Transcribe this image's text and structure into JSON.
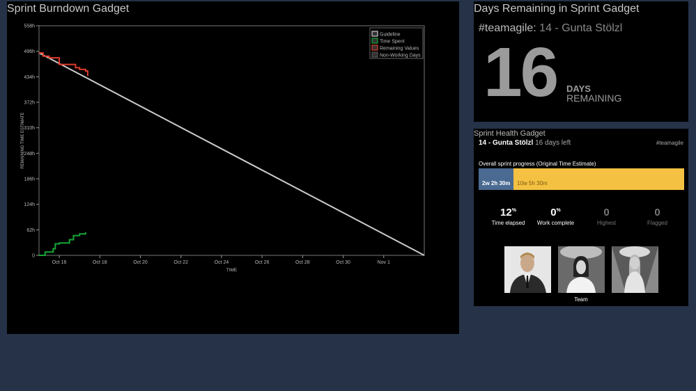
{
  "burndown": {
    "title": "Sprint Burndown Gadget",
    "legend": [
      "Guideline",
      "Time Spent",
      "Remaining Values",
      "Non-Working Days"
    ],
    "legend_colors": [
      "#cccccc",
      "#14a837",
      "#e03c2d",
      "#555555"
    ],
    "chart_data": {
      "type": "line",
      "ylabel": "REMAINING TIME ESTIMATE",
      "xlabel": "TIME",
      "y_ticks": [
        "0",
        "62h",
        "124h",
        "186h",
        "248h",
        "310h",
        "372h",
        "434h",
        "496h",
        "558h"
      ],
      "x_ticks": [
        "Oct 16",
        "Oct 18",
        "Oct 20",
        "Oct 22",
        "Oct 24",
        "Oct 26",
        "Oct 28",
        "Oct 30",
        "Nov 1"
      ],
      "ylim": [
        0,
        558
      ],
      "grid": false,
      "legend_position": "top-right",
      "series": [
        {
          "name": "Guideline",
          "color": "#cccccc",
          "points": [
            [
              "Oct 15",
              492
            ],
            [
              "Nov 3",
              0
            ]
          ]
        },
        {
          "name": "Remaining Values",
          "color": "#e03c2d",
          "points": [
            [
              "Oct 15",
              492
            ],
            [
              "Oct 15.2",
              484
            ],
            [
              "Oct 15.5",
              480
            ],
            [
              "Oct 15.8",
              480
            ],
            [
              "Oct 16",
              464
            ],
            [
              "Oct 16.3",
              464
            ],
            [
              "Oct 16.5",
              464
            ],
            [
              "Oct 16.8",
              456
            ],
            [
              "Oct 17",
              452
            ],
            [
              "Oct 17.3",
              448
            ],
            [
              "Oct 17.4",
              436
            ]
          ]
        },
        {
          "name": "Time Spent",
          "color": "#14a837",
          "points": [
            [
              "Oct 15",
              0
            ],
            [
              "Oct 15.3",
              8
            ],
            [
              "Oct 15.7",
              16
            ],
            [
              "Oct 15.8",
              28
            ],
            [
              "Oct 16",
              30
            ],
            [
              "Oct 16.4",
              30
            ],
            [
              "Oct 16.5",
              38
            ],
            [
              "Oct 16.7",
              48
            ],
            [
              "Oct 17",
              52
            ],
            [
              "Oct 17.3",
              56
            ]
          ]
        }
      ]
    }
  },
  "days_remaining": {
    "title": "Days Remaining in Sprint Gadget",
    "team_tag": "#teamagile:",
    "sprint_name": "14 - Gunta Stölzl",
    "number": "16",
    "days_word": "DAYS",
    "remaining_word": "REMAINING"
  },
  "health": {
    "title": "Sprint Health Gadget",
    "sprint_name": "14 - Gunta Stölzl",
    "days_left": "16 days left",
    "tag": "#teamagile",
    "progress_label": "Overall sprint progress (Original Time Estimate)",
    "done_text": "2w 2h 30m",
    "remaining_text": "10w 5h 30m",
    "done_fraction": 0.17,
    "done_color": "#4a6a92",
    "remaining_color": "#f4c142",
    "metrics": [
      {
        "value": "12",
        "unit": "%",
        "label": "Time elapsed"
      },
      {
        "value": "0",
        "unit": "%",
        "label": "Work complete"
      },
      {
        "value": "0",
        "unit": "",
        "label": "Highest"
      },
      {
        "value": "0",
        "unit": "",
        "label": "Flagged"
      }
    ],
    "team_label": "Team"
  }
}
